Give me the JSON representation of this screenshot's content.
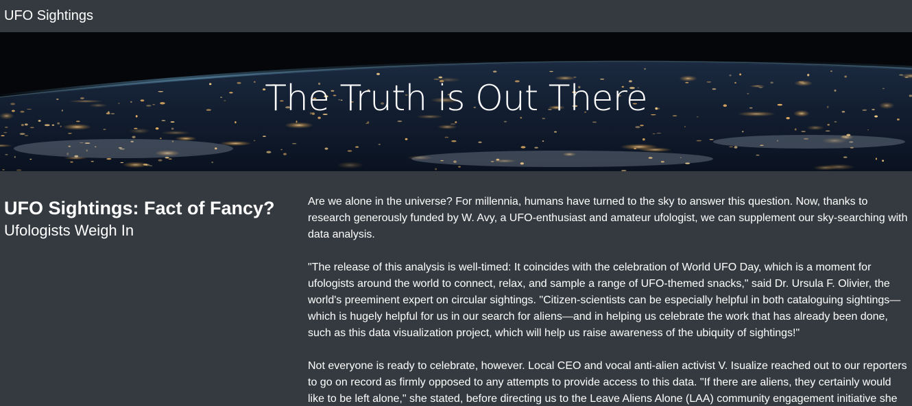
{
  "navbar": {
    "brand": "UFO Sightings"
  },
  "hero": {
    "title": "The Truth is Out There"
  },
  "article": {
    "heading": "UFO Sightings: Fact of Fancy?",
    "subheading": "Ufologists Weigh In",
    "paragraphs": [
      "Are we alone in the universe? For millennia, humans have turned to the sky to answer this question. Now, thanks to research generously funded by W. Avy, a UFO-enthusiast and amateur ufologist, we can supplement our sky-searching with data analysis.",
      "\"The release of this analysis is well-timed: It coincides with the celebration of World UFO Day, which is a moment for ufologists around the world to connect, relax, and sample a range of UFO-themed snacks,\" said Dr. Ursula F. Olivier, the world's preeminent expert on circular sightings. \"Citizen-scientists can be especially helpful in both cataloguing sightings—which is hugely helpful for us in our search for aliens—and in helping us celebrate the work that has already been done, such as this data visualization project, which will help us raise awareness of the ubiquity of sightings!\"",
      "Not everyone is ready to celebrate, however. Local CEO and vocal anti-alien activist V. Isualize reached out to our reporters to go on record as firmly opposed to any attempts to provide access to this data. \"If there are aliens, they certainly would like to be left alone,\" she stated, before directing us to the Leave Aliens Alone (LAA) community engagement initiative she"
    ]
  }
}
